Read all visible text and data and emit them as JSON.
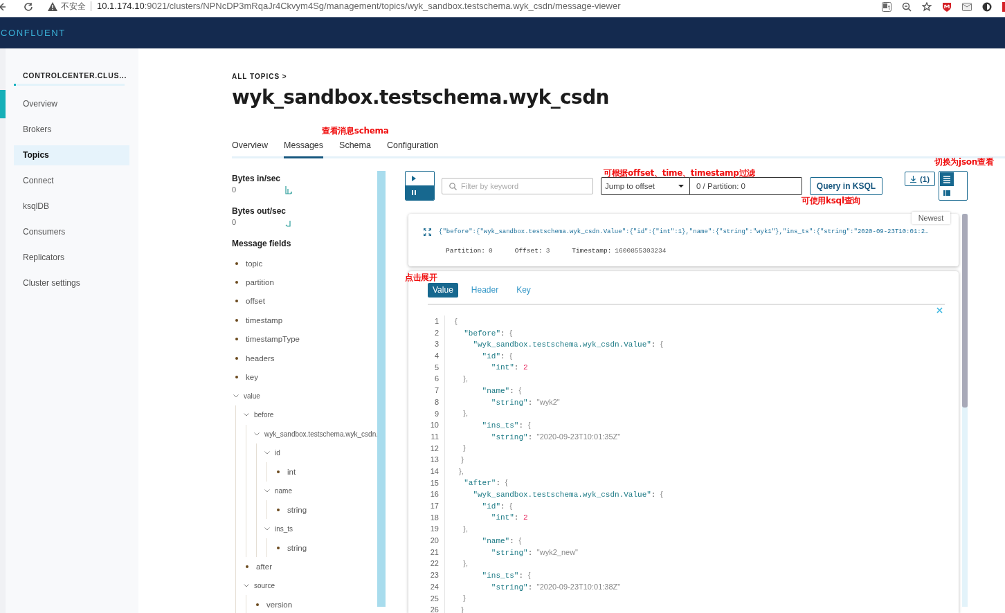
{
  "browser": {
    "security_label": "不安全",
    "url_host": "10.1.174.10",
    "url_path": ":9021/clusters/NPNcDP3mRqaJr4Ckvym4Sg/management/topics/wyk_sandbox.testschema.wyk_csdn/message-viewer"
  },
  "app": {
    "logo": "CONFLUENT"
  },
  "sidebar": {
    "cluster": "CONTROLCENTER.CLUS...",
    "items": [
      {
        "label": "Overview",
        "selected": false
      },
      {
        "label": "Brokers",
        "selected": false
      },
      {
        "label": "Topics",
        "selected": true
      },
      {
        "label": "Connect",
        "selected": false
      },
      {
        "label": "ksqlDB",
        "selected": false
      },
      {
        "label": "Consumers",
        "selected": false
      },
      {
        "label": "Replicators",
        "selected": false
      },
      {
        "label": "Cluster settings",
        "selected": false
      }
    ]
  },
  "breadcrumb": "ALL TOPICS >",
  "title": "wyk_sandbox.testschema.wyk_csdn",
  "tabs": [
    {
      "label": "Overview",
      "selected": false
    },
    {
      "label": "Messages",
      "selected": true
    },
    {
      "label": "Schema",
      "selected": false
    },
    {
      "label": "Configuration",
      "selected": false
    }
  ],
  "metrics": [
    {
      "label": "Bytes in/sec",
      "value": "0"
    },
    {
      "label": "Bytes out/sec",
      "value": "0"
    }
  ],
  "message_fields": {
    "title": "Message fields",
    "fields": [
      {
        "name": "topic",
        "kind": "field"
      },
      {
        "name": "partition",
        "kind": "field"
      },
      {
        "name": "offset",
        "kind": "field"
      },
      {
        "name": "timestamp",
        "kind": "field"
      },
      {
        "name": "timestampType",
        "kind": "field"
      },
      {
        "name": "headers",
        "kind": "field"
      },
      {
        "name": "key",
        "kind": "field"
      },
      {
        "name": "value",
        "kind": "group",
        "expanded": true,
        "children": [
          {
            "name": "before",
            "kind": "group",
            "expanded": true,
            "children": [
              {
                "name": "wyk_sandbox.testschema.wyk_csdn.",
                "kind": "group",
                "expanded": true,
                "children": [
                  {
                    "name": "id",
                    "kind": "group",
                    "expanded": true,
                    "children": [
                      {
                        "name": "int",
                        "kind": "field"
                      }
                    ]
                  },
                  {
                    "name": "name",
                    "kind": "group",
                    "expanded": true,
                    "children": [
                      {
                        "name": "string",
                        "kind": "field"
                      }
                    ]
                  },
                  {
                    "name": "ins_ts",
                    "kind": "group",
                    "expanded": true,
                    "children": [
                      {
                        "name": "string",
                        "kind": "field"
                      }
                    ]
                  }
                ]
              }
            ]
          },
          {
            "name": "after",
            "kind": "field"
          },
          {
            "name": "source",
            "kind": "group",
            "expanded": true,
            "children": [
              {
                "name": "version",
                "kind": "field"
              }
            ]
          }
        ]
      }
    ]
  },
  "stream_controls": [
    {
      "kind": "play",
      "selected": false
    },
    {
      "kind": "pause",
      "selected": true
    }
  ],
  "filter": {
    "placeholder": "Filter by keyword"
  },
  "jump": {
    "option": "Jump to offset",
    "value": "0 / Partition: 0"
  },
  "query_button": "Query in KSQL",
  "download": {
    "count": "(1)"
  },
  "view_toggles": [
    {
      "kind": "list",
      "selected": true
    },
    {
      "kind": "cards",
      "selected": false
    }
  ],
  "tooltip": "Newest",
  "message": {
    "value": "{\"before\":{\"wyk_sandbox.testschema.wyk_csdn.Value\":{\"id\":{\"int\":1},\"name\":{\"string\":\"wyk1\"},\"ins_ts\":{\"string\":\"2020-09-23T10:01:2…",
    "meta": [
      {
        "label": "Partition:",
        "value": "0"
      },
      {
        "label": "Offset:",
        "value": "3"
      },
      {
        "label": "Timestamp:",
        "value": "1600855303234"
      }
    ]
  },
  "detail": {
    "tabs": [
      {
        "label": "Value",
        "selected": true
      },
      {
        "label": "Header",
        "selected": false
      },
      {
        "label": "Key",
        "selected": false
      }
    ],
    "lines": [
      {
        "number": "1",
        "text": "{"
      },
      {
        "number": "2",
        "text": "  \"before\": {"
      },
      {
        "number": "3",
        "text": "    \"wyk_sandbox.testschema.wyk_csdn.Value\": {"
      },
      {
        "number": "4",
        "text": "      \"id\": {"
      },
      {
        "number": "5",
        "text": "        \"int\": 2"
      },
      {
        "number": "6",
        "text": "    },"
      },
      {
        "number": "7",
        "text": "      \"name\": {"
      },
      {
        "number": "8",
        "text": "        \"string\": \"wyk2\""
      },
      {
        "number": "9",
        "text": "    },"
      },
      {
        "number": "10",
        "text": "      \"ins_ts\": {"
      },
      {
        "number": "11",
        "text": "        \"string\": \"2020-09-23T10:01:35Z\""
      },
      {
        "number": "12",
        "text": "    }"
      },
      {
        "number": "13",
        "text": "   }"
      },
      {
        "number": "14",
        "text": "  },"
      },
      {
        "number": "15",
        "text": "  \"after\": {"
      },
      {
        "number": "16",
        "text": "    \"wyk_sandbox.testschema.wyk_csdn.Value\": {"
      },
      {
        "number": "17",
        "text": "      \"id\": {"
      },
      {
        "number": "18",
        "text": "        \"int\": 2"
      },
      {
        "number": "19",
        "text": "    },"
      },
      {
        "number": "20",
        "text": "      \"name\": {"
      },
      {
        "number": "21",
        "text": "        \"string\": \"wyk2_new\""
      },
      {
        "number": "22",
        "text": "    },"
      },
      {
        "number": "23",
        "text": "      \"ins_ts\": {"
      },
      {
        "number": "24",
        "text": "        \"string\": \"2020-09-23T10:01:38Z\""
      },
      {
        "number": "25",
        "text": "    }"
      },
      {
        "number": "26",
        "text": "   }"
      }
    ]
  },
  "annotations": [
    "查看消息schema",
    "可根据offset、time、timestamp过滤",
    "切换为json查看",
    "可使用ksql查询",
    "点击展开"
  ]
}
